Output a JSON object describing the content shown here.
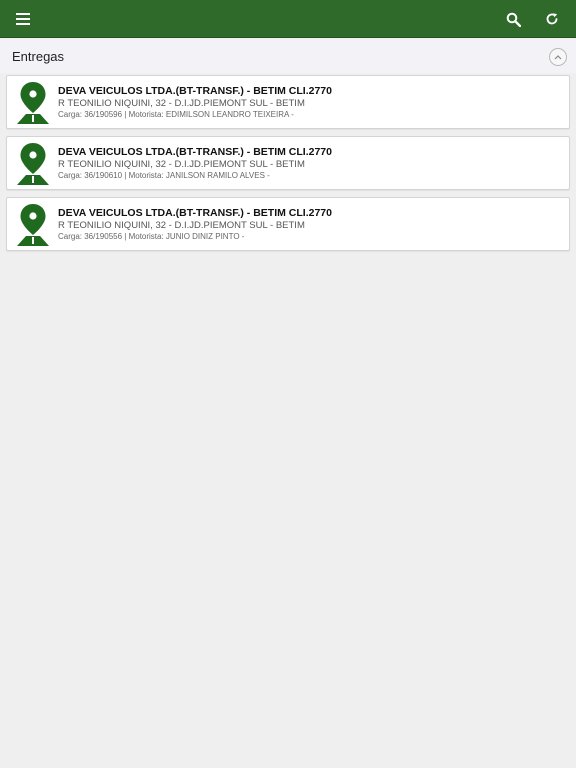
{
  "colors": {
    "topbar": "#2f6a2b",
    "pin": "#1f6a1f",
    "background": "#efefef"
  },
  "topbar": {
    "menu_icon": "hamburger-icon",
    "search_icon": "search-icon",
    "refresh_icon": "refresh-icon"
  },
  "section": {
    "title": "Entregas",
    "collapse_icon": "chevron-up-icon"
  },
  "deliveries": [
    {
      "title": "DEVA VEICULOS LTDA.(BT-TRANSF.) - BETIM CLI.2770",
      "address": "R TEONILIO NIQUINI, 32 - D.I.JD.PIEMONT SUL - BETIM",
      "meta": "Carga: 36/190596 | Motorista: EDIMILSON LEANDRO TEIXEIRA -"
    },
    {
      "title": "DEVA VEICULOS LTDA.(BT-TRANSF.) - BETIM CLI.2770",
      "address": "R TEONILIO NIQUINI, 32 - D.I.JD.PIEMONT SUL - BETIM",
      "meta": "Carga: 36/190610 | Motorista: JANILSON RAMILO ALVES -"
    },
    {
      "title": "DEVA VEICULOS LTDA.(BT-TRANSF.) - BETIM CLI.2770",
      "address": "R TEONILIO NIQUINI, 32 - D.I.JD.PIEMONT SUL - BETIM",
      "meta": "Carga: 36/190556 | Motorista: JUNIO DINIZ PINTO -"
    }
  ]
}
